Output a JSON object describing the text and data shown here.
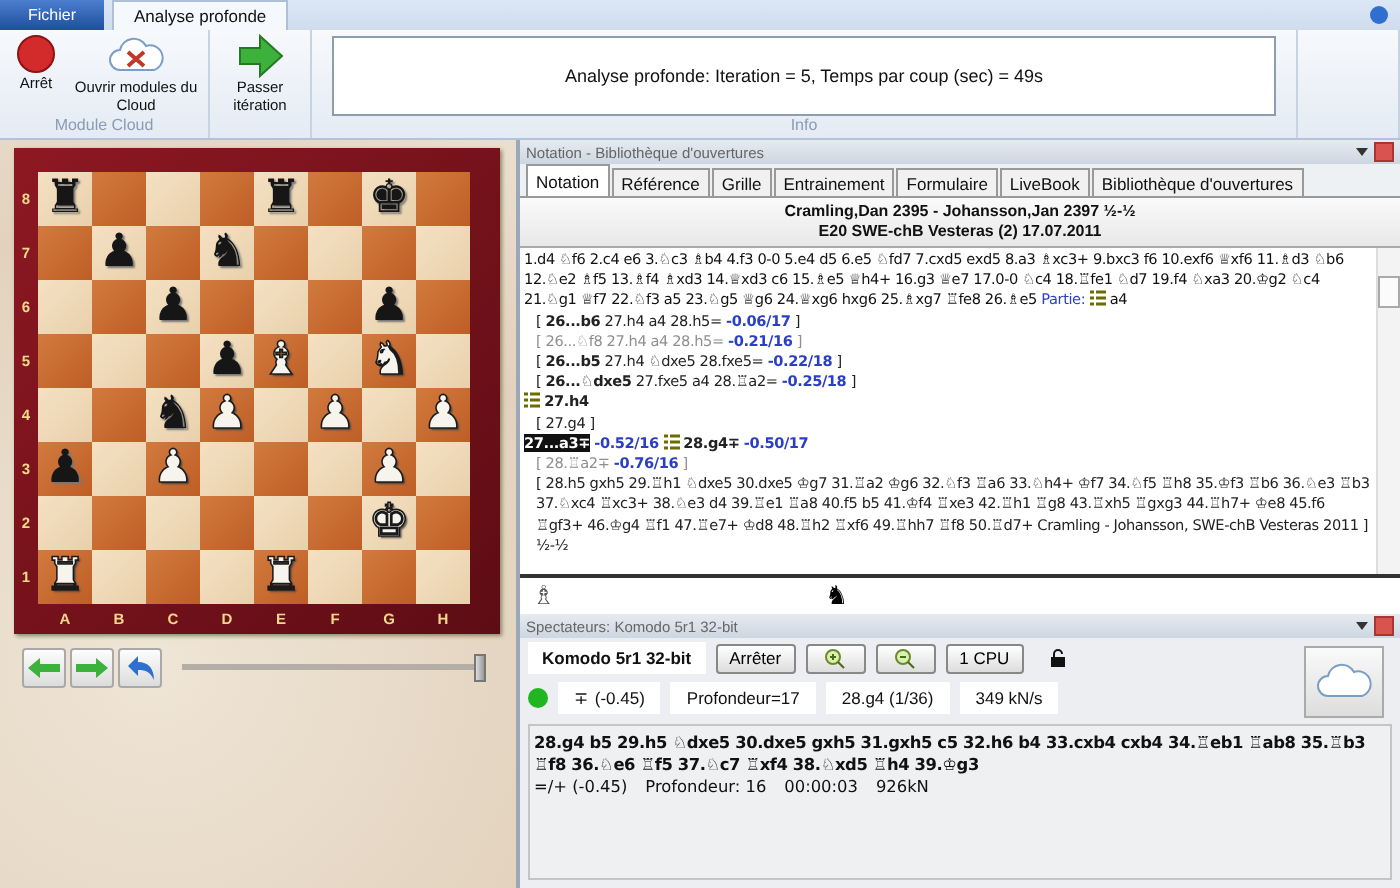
{
  "ribbon": {
    "app_button": "Fichier",
    "tabs": [
      {
        "label": "Analyse profonde",
        "selected": true
      }
    ],
    "groups": [
      {
        "label": "Module Cloud",
        "buttons": [
          {
            "kind": "stop",
            "label": "Arrêt"
          },
          {
            "kind": "cloud",
            "label": "Ouvrir modules du Cloud"
          }
        ]
      },
      {
        "buttons": [
          {
            "kind": "next",
            "label": "Passer itération"
          }
        ]
      }
    ],
    "info": {
      "label": "Info",
      "text": "Analyse profonde: Iteration = 5, Temps par coup (sec) = 49s"
    }
  },
  "board": {
    "ranks": [
      "8",
      "7",
      "6",
      "5",
      "4",
      "3",
      "2",
      "1"
    ],
    "files": [
      "A",
      "B",
      "C",
      "D",
      "E",
      "F",
      "G",
      "H"
    ],
    "rows": [
      {
        "squares": [
          {
            "dark": false,
            "piece": "♜",
            "white": false
          },
          {
            "dark": true
          },
          {
            "dark": false
          },
          {
            "dark": true
          },
          {
            "dark": false,
            "piece": "♜",
            "white": false
          },
          {
            "dark": true
          },
          {
            "dark": false,
            "piece": "♚",
            "white": false
          },
          {
            "dark": true
          }
        ]
      },
      {
        "squares": [
          {
            "dark": true
          },
          {
            "dark": false,
            "piece": "♟",
            "white": false
          },
          {
            "dark": true
          },
          {
            "dark": false,
            "piece": "♞",
            "white": false
          },
          {
            "dark": true
          },
          {
            "dark": false
          },
          {
            "dark": true
          },
          {
            "dark": false
          }
        ]
      },
      {
        "squares": [
          {
            "dark": false
          },
          {
            "dark": true
          },
          {
            "dark": false,
            "piece": "♟",
            "white": false
          },
          {
            "dark": true
          },
          {
            "dark": false
          },
          {
            "dark": true
          },
          {
            "dark": false,
            "piece": "♟",
            "white": false
          },
          {
            "dark": true
          }
        ]
      },
      {
        "squares": [
          {
            "dark": true
          },
          {
            "dark": false
          },
          {
            "dark": true
          },
          {
            "dark": false,
            "piece": "♟",
            "white": false
          },
          {
            "dark": true,
            "piece": "♝",
            "white": true
          },
          {
            "dark": false
          },
          {
            "dark": true,
            "piece": "♞",
            "white": true
          },
          {
            "dark": false
          }
        ]
      },
      {
        "squares": [
          {
            "dark": false
          },
          {
            "dark": true
          },
          {
            "dark": false,
            "piece": "♞",
            "white": false
          },
          {
            "dark": true,
            "piece": "♟",
            "white": true
          },
          {
            "dark": false
          },
          {
            "dark": true,
            "piece": "♟",
            "white": true
          },
          {
            "dark": false
          },
          {
            "dark": true,
            "piece": "♟",
            "white": true
          }
        ]
      },
      {
        "squares": [
          {
            "dark": true,
            "piece": "♟",
            "white": false
          },
          {
            "dark": false
          },
          {
            "dark": true,
            "piece": "♟",
            "white": true
          },
          {
            "dark": false
          },
          {
            "dark": true
          },
          {
            "dark": false
          },
          {
            "dark": true,
            "piece": "♟",
            "white": true
          },
          {
            "dark": false
          }
        ]
      },
      {
        "squares": [
          {
            "dark": false
          },
          {
            "dark": true
          },
          {
            "dark": false
          },
          {
            "dark": true
          },
          {
            "dark": false
          },
          {
            "dark": true
          },
          {
            "dark": false,
            "piece": "♚",
            "white": true
          },
          {
            "dark": true
          }
        ]
      },
      {
        "squares": [
          {
            "dark": true,
            "piece": "♜",
            "white": true
          },
          {
            "dark": false
          },
          {
            "dark": true
          },
          {
            "dark": false
          },
          {
            "dark": true,
            "piece": "♜",
            "white": true
          },
          {
            "dark": false
          },
          {
            "dark": true
          },
          {
            "dark": false
          }
        ]
      }
    ]
  },
  "board_controls": {
    "slider": {
      "level": 1.0
    }
  },
  "notation_panel": {
    "title": "Notation - Bibliothèque d'ouvertures",
    "tabs": [
      {
        "label": "Notation",
        "selected": true
      },
      {
        "label": "Référence",
        "selected": false
      },
      {
        "label": "Grille",
        "selected": false
      },
      {
        "label": "Entrainement",
        "selected": false
      },
      {
        "label": "Formulaire",
        "selected": false
      },
      {
        "label": "LiveBook",
        "selected": false
      },
      {
        "label": "Bibliothèque d'ouvertures",
        "selected": false
      }
    ],
    "players": "Cramling,Dan 2395 - Johansson,Jan 2397  ½-½",
    "event": "E20  SWE-chB Vesteras (2) 17.07.2011",
    "mainline": "1.d4 ♘f6 2.c4 e6 3.♘c3 ♗b4 4.f3 0-0 5.e4 d5 6.e5 ♘fd7 7.cxd5 exd5 8.a3 ♗xc3+ 9.bxc3 f6 10.exf6 ♕xf6 11.♗d3 ♘b6 12.♘e2 ♗f5 13.♗f4 ♗xd3 14.♕xd3 c6 15.♗e5 ♕h4+ 16.g3 ♕e7 17.0-0 ♘c4 18.♖fe1 ♘d7 19.f4 ♘xa3 20.♔g2 ♘c4 21.♘g1 ♕f7 22.♘f3 a5 23.♘g5 ♕g6 24.♕xg6 hxg6 25.♗xg7 ♖fe8 26.♗e5",
    "game_label": "Partie:",
    "game_move": "a4",
    "lines": [
      {
        "kind": "variation",
        "text": "[ **26...b6** 27.h4 a4 28.h5=",
        "eval": "-0.06/17",
        "close": "]"
      },
      {
        "kind": "dim",
        "text": "[ 26...♘f8 27.h4 a4 28.h5=",
        "eval": "-0.21/16",
        "close": "]"
      },
      {
        "kind": "variation",
        "text": "[ **26...b5** 27.h4 ♘dxe5 28.fxe5=",
        "eval": "-0.22/18",
        "close": "]"
      },
      {
        "kind": "variation",
        "text": "[ **26...♘dxe5** 27.fxe5 a4 28.♖a2=",
        "eval": "-0.25/18",
        "close": "]"
      },
      {
        "kind": "move",
        "text": "27.h4"
      },
      {
        "kind": "plain",
        "text": "[ 27.g4 ]"
      },
      {
        "kind": "current",
        "text": "27...a3∓",
        "eval": "-0.52/16",
        "next": "28.g4∓",
        "next_eval": "-0.50/17"
      },
      {
        "kind": "dim",
        "text": "[ 28.♖a2∓",
        "eval": "-0.76/16",
        "close": "]"
      },
      {
        "kind": "plain",
        "text": "[ 28.h5 gxh5 29.♖h1 ♘dxe5 30.dxe5 ♔g7 31.♖a2 ♔g6 32.♘f3 ♖a6 33.♘h4+ ♔f7 34.♘f5 ♖h8 35.♔f3 ♖b6 36.♘e3 ♖b3 37.♘xc4 ♖xc3+ 38.♘e3 d4 39.♖e1 ♖a8 40.f5 b5 41.♔f4 ♖xe3 42.♖h1 ♖g8 43.♖xh5 ♖gxg3 44.♖h7+ ♔e8 45.f6 ♖gf3+ 46.♔g4 ♖f1 47.♖e7+ ♔d8 48.♖h2 ♖xf6 49.♖hh7 ♖f8 50.♖d7+ Cramling - Johansson, SWE-chB Vesteras 2011 ]"
      },
      {
        "kind": "plain",
        "text": "½-½"
      }
    ]
  },
  "players_strip": {
    "left": "♗",
    "right": "♞"
  },
  "engine_panel": {
    "title": "Spectateurs: Komodo 5r1 32-bit",
    "engine": "Komodo 5r1 32-bit",
    "stop_button": "Arrêter",
    "cpu_button": "1 CPU",
    "status": {
      "color": "#22b522"
    },
    "stats": [
      "∓ (-0.45)",
      "Profondeur=17",
      "28.g4 (1/36)",
      "349 kN/s"
    ],
    "line": "28.g4 b5 29.h5 ♘dxe5 30.dxe5 gxh5 31.gxh5 c5 32.h6 b4 33.cxb4 cxb4 34.♖eb1 ♖ab8 35.♖b3 ♖f8 36.♘e6 ♖f5 37.♘c7 ♖xf4 38.♘xd5 ♖h4 39.♔g3",
    "summary": [
      "=/+ (-0.45)",
      "Profondeur: 16",
      "00:00:03",
      "926kN"
    ]
  }
}
